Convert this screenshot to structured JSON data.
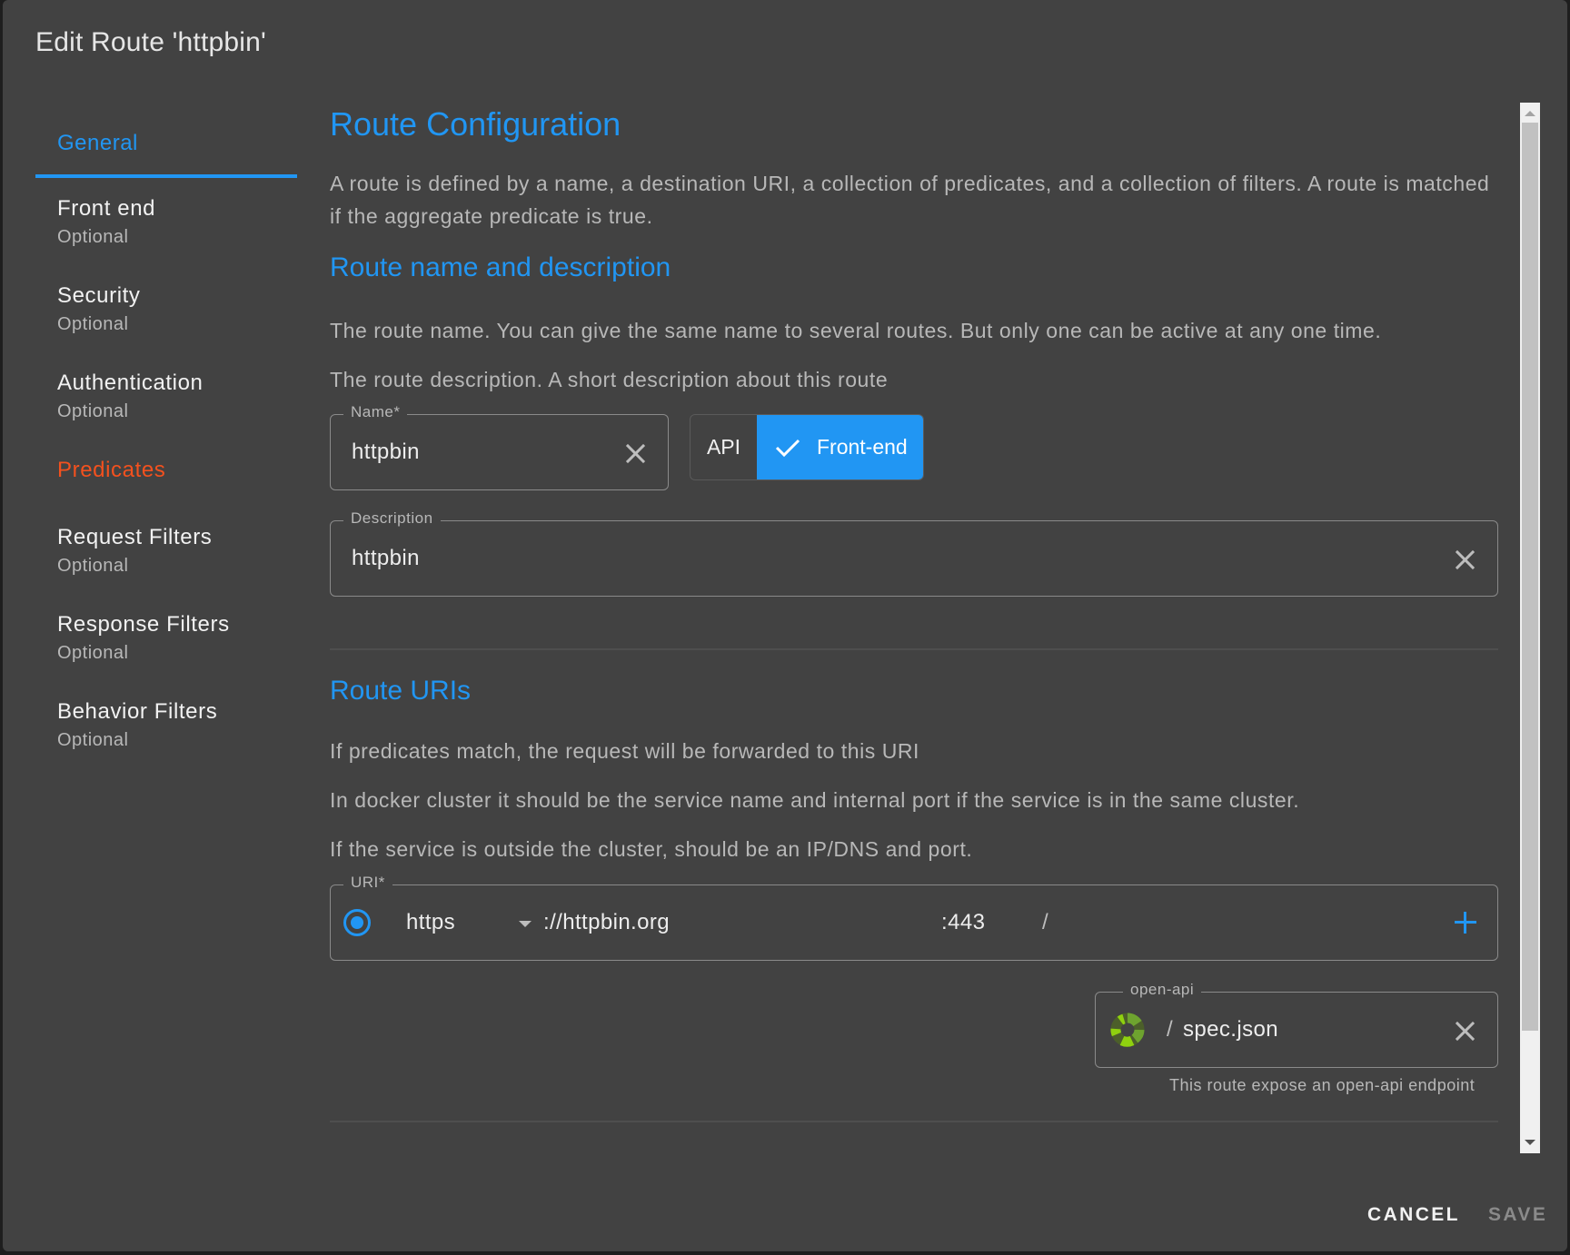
{
  "dialog": {
    "title": "Edit Route 'httpbin'"
  },
  "sidebar": {
    "items": [
      {
        "label": "General",
        "active": true
      },
      {
        "label": "Front end",
        "sub": "Optional"
      },
      {
        "label": "Security",
        "sub": "Optional"
      },
      {
        "label": "Authentication",
        "sub": "Optional"
      },
      {
        "label": "Predicates",
        "error": true
      },
      {
        "label": "Request Filters",
        "sub": "Optional"
      },
      {
        "label": "Response Filters",
        "sub": "Optional"
      },
      {
        "label": "Behavior Filters",
        "sub": "Optional"
      }
    ]
  },
  "content": {
    "title": "Route Configuration",
    "intro": "A route is defined by a name, a destination URI, a collection of predicates, and a collection of filters. A route is matched if the aggregate predicate is true.",
    "name_section": {
      "title": "Route name and description",
      "help1": "The route name. You can give the same name to several routes. But only one can be active at any one time.",
      "help2": "The route description. A short description about this route",
      "name_label": "Name*",
      "name_value": "httpbin",
      "type_options": [
        "API",
        "Front-end"
      ],
      "type_selected": "Front-end",
      "description_label": "Description",
      "description_value": "httpbin"
    },
    "uri_section": {
      "title": "Route URIs",
      "help1": "If predicates match, the request will be forwarded to this URI",
      "help2": "In docker cluster it should be the service name and internal port if the service is in the same cluster.",
      "help3": "If the service is outside the cluster, should be an IP/DNS and port.",
      "uri_label": "URI*",
      "scheme": "https",
      "host": "://httpbin.org",
      "port": ":443",
      "path": "/",
      "openapi_label": "open-api",
      "openapi_prefix": "/",
      "openapi_value": "spec.json",
      "openapi_hint": "This route expose an open-api endpoint"
    }
  },
  "footer": {
    "cancel": "CANCEL",
    "save": "SAVE"
  },
  "colors": {
    "accent": "#2196f3",
    "error": "#f4511e",
    "background": "#424242"
  }
}
